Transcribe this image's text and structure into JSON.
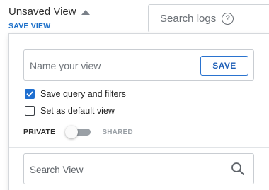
{
  "header": {
    "view_title": "Unsaved View",
    "save_view_link": "SAVE VIEW",
    "search_logs_placeholder": "Search logs",
    "help_icon": "?"
  },
  "panel": {
    "name_placeholder": "Name your view",
    "name_value": "",
    "save_button": "SAVE",
    "options": [
      {
        "label": "Save query and filters",
        "checked": true
      },
      {
        "label": "Set as default view",
        "checked": false
      }
    ],
    "privacy": {
      "private_label": "PRIVATE",
      "shared_label": "SHARED",
      "is_shared": false
    },
    "search_view_placeholder": "Search View"
  },
  "colors": {
    "accent": "#1f6fd0",
    "link": "#1b6fc9",
    "toggle_off": "#9aa0a6"
  },
  "icons": [
    "caret-up-icon",
    "help-icon",
    "checkmark-icon",
    "search-icon"
  ]
}
